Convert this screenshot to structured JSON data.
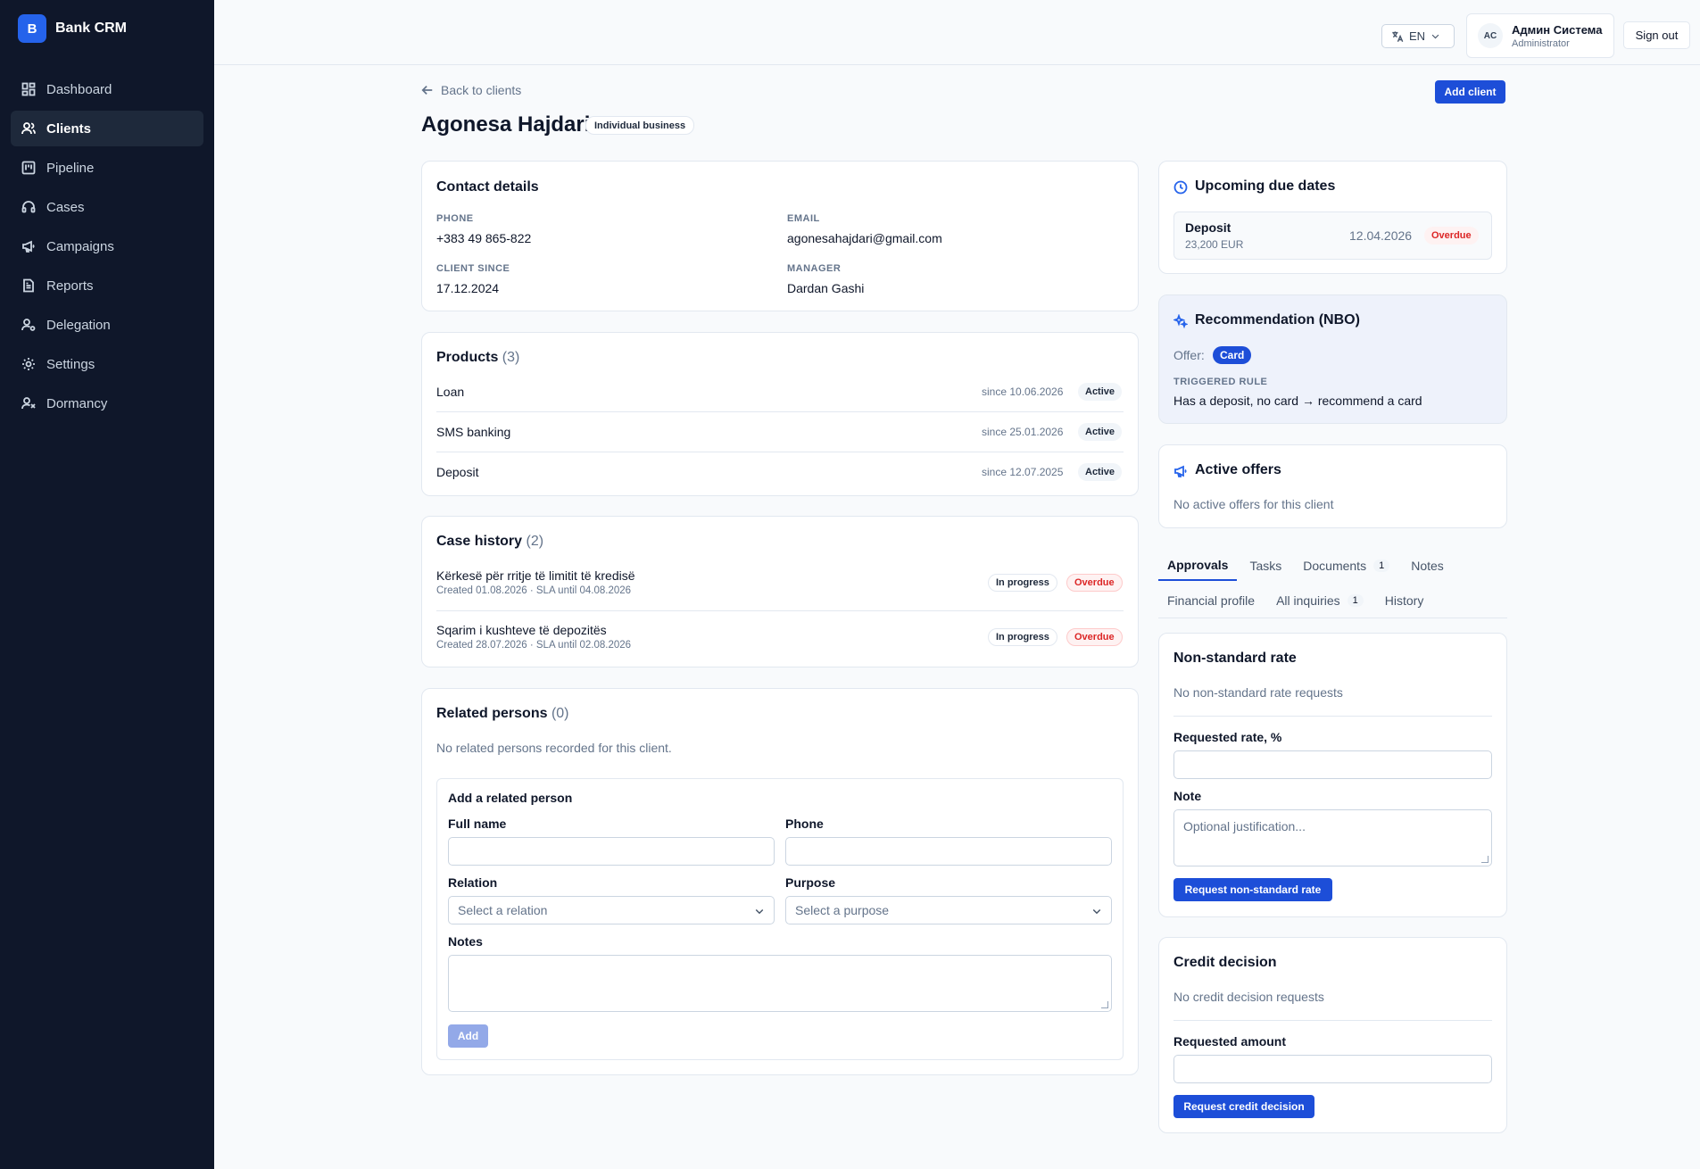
{
  "brand": {
    "logo_letter": "B",
    "name": "Bank CRM"
  },
  "sidebar": {
    "items": [
      {
        "label": "Dashboard",
        "icon": "dashboard-icon"
      },
      {
        "label": "Clients",
        "icon": "users-icon",
        "active": true
      },
      {
        "label": "Pipeline",
        "icon": "pipeline-icon"
      },
      {
        "label": "Cases",
        "icon": "headset-icon"
      },
      {
        "label": "Campaigns",
        "icon": "megaphone-icon"
      },
      {
        "label": "Reports",
        "icon": "report-icon"
      },
      {
        "label": "Delegation",
        "icon": "delegation-icon"
      },
      {
        "label": "Settings",
        "icon": "gear-icon"
      },
      {
        "label": "Dormancy",
        "icon": "dormancy-icon"
      }
    ]
  },
  "header": {
    "language": "EN",
    "user_initials": "AC",
    "user_name": "Админ Система",
    "user_role": "Administrator",
    "sign_out": "Sign out"
  },
  "page": {
    "back_link": "Back to clients",
    "add_client": "Add client",
    "client_name": "Agonesa Hajdari",
    "client_type": "Individual business"
  },
  "contact": {
    "title": "Contact details",
    "phone_label": "PHONE",
    "phone": "+383 49 865-822",
    "email_label": "EMAIL",
    "email": "agonesahajdari@gmail.com",
    "since_label": "CLIENT SINCE",
    "since": "17.12.2024",
    "manager_label": "MANAGER",
    "manager": "Dardan Gashi"
  },
  "products": {
    "title": "Products",
    "count": "(3)",
    "items": [
      {
        "name": "Loan",
        "since": "since 10.06.2026",
        "status": "Active"
      },
      {
        "name": "SMS banking",
        "since": "since 25.01.2026",
        "status": "Active"
      },
      {
        "name": "Deposit",
        "since": "since 12.07.2025",
        "status": "Active"
      }
    ]
  },
  "cases": {
    "title": "Case history",
    "count": "(2)",
    "items": [
      {
        "title": "Kërkesë për rritje të limitit të kredisë",
        "meta": "Created 01.08.2026 · SLA until 04.08.2026",
        "status": "In progress",
        "flag": "Overdue"
      },
      {
        "title": "Sqarim i kushteve të depozitës",
        "meta": "Created 28.07.2026 · SLA until 02.08.2026",
        "status": "In progress",
        "flag": "Overdue"
      }
    ]
  },
  "related": {
    "title": "Related persons",
    "count": "(0)",
    "empty": "No related persons recorded for this client.",
    "form_title": "Add a related person",
    "full_name_label": "Full name",
    "phone_label": "Phone",
    "relation_label": "Relation",
    "relation_placeholder": "Select a relation",
    "purpose_label": "Purpose",
    "purpose_placeholder": "Select a purpose",
    "notes_label": "Notes",
    "add_button": "Add"
  },
  "due_dates": {
    "title": "Upcoming due dates",
    "item_name": "Deposit",
    "item_amount": "23,200 EUR",
    "item_date": "12.04.2026",
    "item_flag": "Overdue"
  },
  "nbo": {
    "title": "Recommendation (NBO)",
    "offer_label": "Offer:",
    "offer": "Card",
    "rule_label": "TRIGGERED RULE",
    "rule": "Has a deposit, no card → recommend a card"
  },
  "offers": {
    "title": "Active offers",
    "empty": "No active offers for this client"
  },
  "tabs": {
    "approvals": "Approvals",
    "tasks": "Tasks",
    "documents": "Documents",
    "documents_count": "1",
    "notes": "Notes",
    "financial": "Financial profile",
    "inquiries": "All inquiries",
    "inquiries_count": "1",
    "history": "History"
  },
  "rate": {
    "title": "Non-standard rate",
    "empty": "No non-standard rate requests",
    "rate_label": "Requested rate, %",
    "note_label": "Note",
    "note_placeholder": "Optional justification...",
    "button": "Request non-standard rate"
  },
  "credit": {
    "title": "Credit decision",
    "empty": "No credit decision requests",
    "amount_label": "Requested amount",
    "button": "Request credit decision"
  },
  "colors": {
    "sidebar_bg": "#0f172a",
    "primary": "#1d4ed8",
    "danger": "#dc2626"
  }
}
